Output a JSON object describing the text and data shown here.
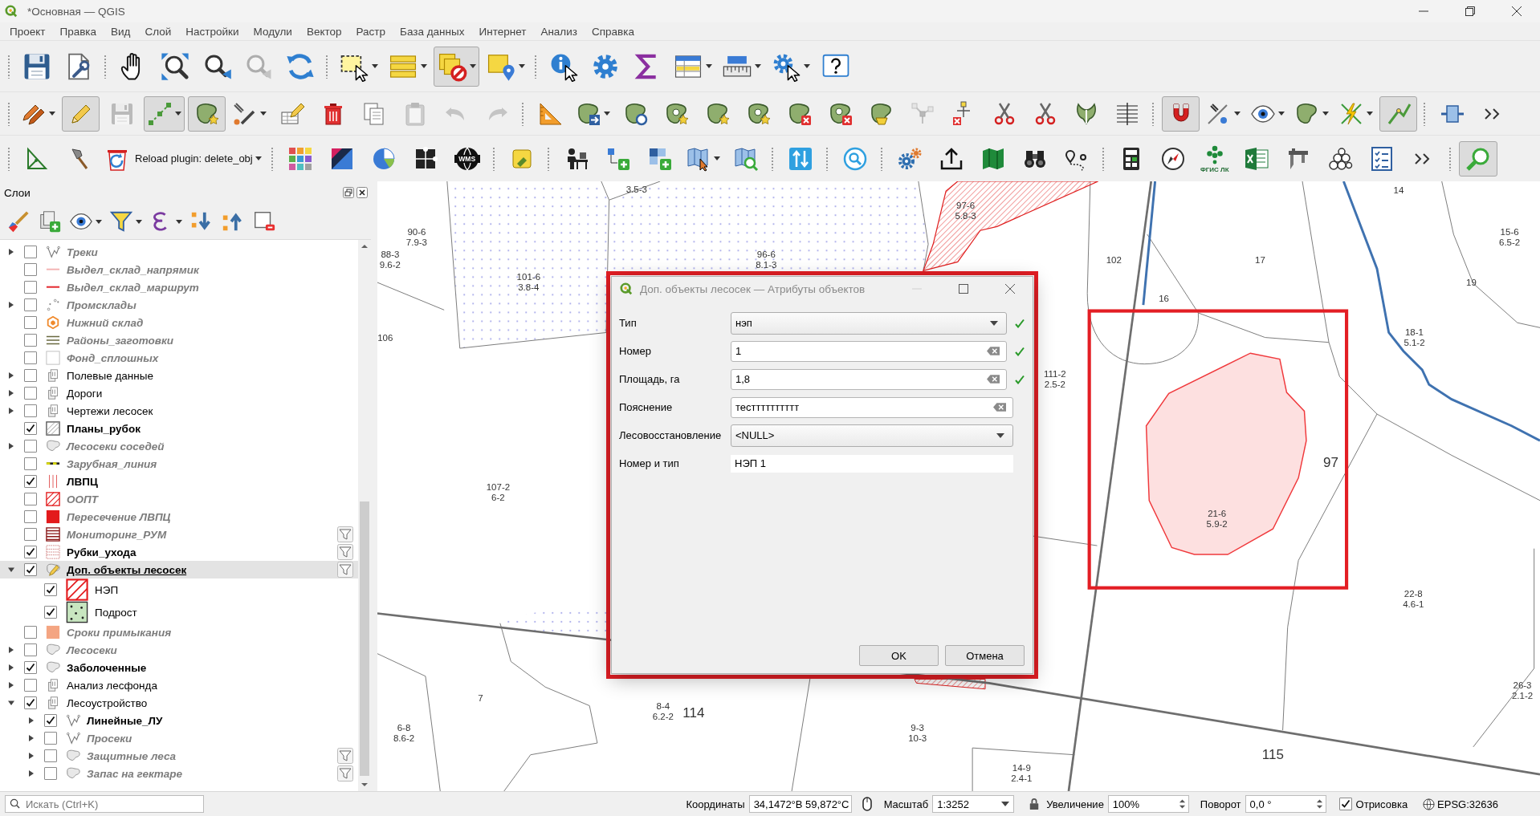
{
  "window": {
    "title": "*Основная — QGIS"
  },
  "menu": [
    "Проект",
    "Правка",
    "Вид",
    "Слой",
    "Настройки",
    "Модули",
    "Вектор",
    "Растр",
    "База данных",
    "Интернет",
    "Анализ",
    "Справка"
  ],
  "toolbars": [
    {
      "buttons": [
        {
          "pressed": false,
          "disabled": false
        },
        {
          "pressed": false,
          "disabled": false
        },
        {
          "pressed": false,
          "disabled": false
        },
        {
          "pressed": false,
          "disabled": false
        },
        {
          "pressed": false,
          "disabled": false
        },
        {
          "pressed": false,
          "disabled": true
        },
        {
          "pressed": false,
          "disabled": false
        },
        {
          "pressed": false,
          "disabled": false
        },
        {
          "pressed": false,
          "disabled": false
        },
        {
          "pressed": true,
          "disabled": false
        },
        {
          "pressed": false,
          "disabled": false
        },
        {
          "pressed": false,
          "disabled": false
        },
        {
          "pressed": false,
          "disabled": false
        },
        {
          "pressed": false,
          "disabled": false
        },
        {
          "pressed": false,
          "disabled": false
        },
        {
          "pressed": false,
          "disabled": false
        },
        {
          "pressed": false,
          "disabled": false
        },
        {
          "pressed": false,
          "disabled": false
        }
      ]
    },
    {
      "buttons": [
        {
          "pressed": false,
          "disabled": false
        },
        {
          "pressed": true,
          "disabled": false
        },
        {
          "pressed": false,
          "disabled": true
        },
        {
          "pressed": true,
          "disabled": false
        },
        {
          "pressed": true,
          "disabled": false
        },
        {
          "pressed": false,
          "disabled": false
        },
        {
          "pressed": false,
          "disabled": false
        },
        {
          "pressed": false,
          "disabled": false
        },
        {
          "pressed": false,
          "disabled": false
        },
        {
          "pressed": false,
          "disabled": true
        },
        {
          "pressed": false,
          "disabled": true
        },
        {
          "pressed": false,
          "disabled": true
        },
        {
          "pressed": false,
          "disabled": false
        },
        {
          "pressed": false,
          "disabled": false
        },
        {
          "pressed": false,
          "disabled": false
        },
        {
          "pressed": false,
          "disabled": false
        },
        {
          "pressed": false,
          "disabled": false
        },
        {
          "pressed": false,
          "disabled": false
        },
        {
          "pressed": false,
          "disabled": false
        },
        {
          "pressed": false,
          "disabled": false
        },
        {
          "pressed": false,
          "disabled": false
        },
        {
          "pressed": false,
          "disabled": true
        },
        {
          "pressed": false,
          "disabled": false
        },
        {
          "pressed": false,
          "disabled": false
        },
        {
          "pressed": false,
          "disabled": false
        },
        {
          "pressed": false,
          "disabled": false
        },
        {
          "pressed": false,
          "disabled": false
        },
        {
          "pressed": true,
          "disabled": false
        },
        {
          "pressed": false,
          "disabled": false
        },
        {
          "pressed": false,
          "disabled": false
        },
        {
          "pressed": false,
          "disabled": false
        },
        {
          "pressed": false,
          "disabled": false
        },
        {
          "pressed": true,
          "disabled": false
        },
        {
          "pressed": false,
          "disabled": false
        },
        {
          "pressed": false,
          "disabled": false
        }
      ]
    },
    {
      "buttons": [
        {
          "pressed": false,
          "disabled": false
        },
        {
          "pressed": false,
          "disabled": false
        },
        {
          "pressed": false,
          "disabled": false,
          "label": "Reload plugin: delete_obj"
        },
        {
          "pressed": false,
          "disabled": false
        },
        {
          "pressed": false,
          "disabled": false
        },
        {
          "pressed": false,
          "disabled": false
        },
        {
          "pressed": false,
          "disabled": false
        },
        {
          "pressed": false,
          "disabled": false,
          "label": "WMS"
        },
        {
          "pressed": false,
          "disabled": false
        },
        {
          "pressed": false,
          "disabled": false
        },
        {
          "pressed": false,
          "disabled": false
        },
        {
          "pressed": false,
          "disabled": false
        },
        {
          "pressed": false,
          "disabled": false
        },
        {
          "pressed": false,
          "disabled": false
        },
        {
          "pressed": false,
          "disabled": false
        },
        {
          "pressed": false,
          "disabled": false
        },
        {
          "pressed": false,
          "disabled": false
        },
        {
          "pressed": false,
          "disabled": false
        },
        {
          "pressed": false,
          "disabled": false
        },
        {
          "pressed": false,
          "disabled": false
        },
        {
          "pressed": false,
          "disabled": false
        },
        {
          "pressed": false,
          "disabled": false
        },
        {
          "pressed": false,
          "disabled": false
        },
        {
          "pressed": false,
          "disabled": false,
          "label": "ФГИС ЛК"
        },
        {
          "pressed": false,
          "disabled": false
        },
        {
          "pressed": false,
          "disabled": false
        },
        {
          "pressed": false,
          "disabled": false
        },
        {
          "pressed": false,
          "disabled": false
        },
        {
          "pressed": false,
          "disabled": false
        },
        {
          "pressed": true,
          "disabled": false
        }
      ]
    }
  ],
  "layers_panel": {
    "title": "Слои",
    "layers": [
      {
        "name": "Треки",
        "kind": "track",
        "legend": false,
        "expandable": true,
        "expanded": false,
        "checked": false,
        "greyed": true,
        "bold": true,
        "selected": false,
        "filtered": false
      },
      {
        "name": "Выдел_склад_напрямик",
        "kind": "line",
        "color": "#f4b4b4",
        "legend": false,
        "expandable": false,
        "expanded": false,
        "checked": false,
        "greyed": true,
        "bold": true,
        "selected": false,
        "filtered": false
      },
      {
        "name": "Выдел_склад_маршрут",
        "kind": "line",
        "color": "#e3262b",
        "legend": false,
        "expandable": false,
        "expanded": false,
        "checked": false,
        "greyed": true,
        "bold": true,
        "selected": false,
        "filtered": false
      },
      {
        "name": "Промсклады",
        "kind": "points",
        "legend": false,
        "expandable": true,
        "expanded": false,
        "checked": false,
        "greyed": true,
        "bold": true,
        "selected": false,
        "filtered": false
      },
      {
        "name": "Нижний склад",
        "kind": "hexagon",
        "legend": false,
        "expandable": false,
        "expanded": false,
        "checked": false,
        "greyed": true,
        "bold": true,
        "selected": false,
        "filtered": false
      },
      {
        "name": "Районы_заготовки",
        "kind": "stripes",
        "legend": false,
        "expandable": false,
        "expanded": false,
        "checked": false,
        "greyed": true,
        "bold": true,
        "selected": false,
        "filtered": false
      },
      {
        "name": "Фонд_сплошных",
        "kind": "blank",
        "legend": false,
        "expandable": false,
        "expanded": false,
        "checked": false,
        "greyed": true,
        "bold": true,
        "selected": false,
        "filtered": false
      },
      {
        "name": "Полевые данные",
        "kind": "group",
        "legend": false,
        "expandable": true,
        "expanded": false,
        "checked": false,
        "greyed": false,
        "bold": false,
        "selected": false,
        "filtered": false
      },
      {
        "name": "Дороги",
        "kind": "group",
        "legend": false,
        "expandable": true,
        "expanded": false,
        "checked": false,
        "greyed": false,
        "bold": false,
        "selected": false,
        "filtered": false
      },
      {
        "name": "Чертежи лесосек",
        "kind": "group",
        "legend": false,
        "expandable": true,
        "expanded": false,
        "checked": false,
        "greyed": false,
        "bold": false,
        "selected": false,
        "filtered": false
      },
      {
        "name": "Планы_рубок",
        "kind": "hatch",
        "legend": false,
        "expandable": false,
        "expanded": false,
        "checked": true,
        "greyed": false,
        "bold": true,
        "selected": false,
        "filtered": false
      },
      {
        "name": "Лесосеки соседей",
        "kind": "blob",
        "legend": false,
        "expandable": true,
        "expanded": false,
        "checked": false,
        "greyed": true,
        "bold": true,
        "selected": false,
        "filtered": false
      },
      {
        "name": "Зарубная_линия",
        "kind": "dashline",
        "legend": false,
        "expandable": false,
        "expanded": false,
        "checked": false,
        "greyed": true,
        "bold": true,
        "selected": false,
        "filtered": false
      },
      {
        "name": "ЛВПЦ",
        "kind": "vlines",
        "legend": false,
        "expandable": false,
        "expanded": false,
        "checked": true,
        "greyed": false,
        "bold": true,
        "selected": false,
        "filtered": false
      },
      {
        "name": "ООПТ",
        "kind": "diagonal",
        "legend": false,
        "expandable": false,
        "expanded": false,
        "checked": false,
        "greyed": true,
        "bold": true,
        "selected": false,
        "filtered": false
      },
      {
        "name": "Пересечение ЛВПЦ",
        "kind": "fill",
        "color": "#e31a1c",
        "legend": false,
        "expandable": false,
        "expanded": false,
        "checked": false,
        "greyed": true,
        "bold": true,
        "selected": false,
        "filtered": false
      },
      {
        "name": "Мониторинг_РУМ",
        "kind": "bars",
        "legend": false,
        "expandable": false,
        "expanded": false,
        "checked": false,
        "greyed": true,
        "bold": true,
        "selected": false,
        "filtered": true
      },
      {
        "name": "Рубки_ухода",
        "kind": "grid",
        "legend": false,
        "expandable": false,
        "expanded": false,
        "checked": true,
        "greyed": false,
        "bold": true,
        "selected": false,
        "filtered": true
      },
      {
        "name": "Доп. объекты лесосек",
        "kind": "edit",
        "legend": false,
        "expandable": true,
        "expanded": true,
        "checked": true,
        "greyed": false,
        "bold": true,
        "selected": true,
        "filtered": true,
        "children": [
          {
            "name": "НЭП",
            "kind": "diagonal",
            "legend": true,
            "expandable": false,
            "expanded": false,
            "checked": true,
            "greyed": false,
            "bold": false,
            "selected": false,
            "filtered": false
          },
          {
            "name": "Подрост",
            "kind": "dots",
            "legend": true,
            "expandable": false,
            "expanded": false,
            "checked": true,
            "greyed": false,
            "bold": false,
            "selected": false,
            "filtered": false
          }
        ]
      },
      {
        "name": "Сроки примыкания",
        "kind": "fill",
        "color": "#f4a582",
        "legend": false,
        "expandable": false,
        "expanded": false,
        "checked": false,
        "greyed": true,
        "bold": true,
        "selected": false,
        "filtered": false
      },
      {
        "name": "Лесосеки",
        "kind": "blob",
        "legend": false,
        "expandable": true,
        "expanded": false,
        "checked": false,
        "greyed": true,
        "bold": true,
        "selected": false,
        "filtered": false
      },
      {
        "name": "Заболоченные",
        "kind": "blob",
        "legend": false,
        "expandable": true,
        "expanded": false,
        "checked": true,
        "greyed": false,
        "bold": true,
        "selected": false,
        "filtered": false
      },
      {
        "name": "Анализ лесфонда",
        "kind": "group",
        "legend": false,
        "expandable": true,
        "expanded": false,
        "checked": false,
        "greyed": false,
        "bold": false,
        "selected": false,
        "filtered": false
      },
      {
        "name": "Лесоустройство",
        "kind": "group",
        "legend": false,
        "expandable": true,
        "expanded": true,
        "checked": true,
        "greyed": false,
        "bold": false,
        "selected": false,
        "filtered": false,
        "children": [
          {
            "name": "Линейные_ЛУ",
            "kind": "track",
            "legend": false,
            "expandable": true,
            "expanded": false,
            "checked": true,
            "greyed": false,
            "bold": true,
            "selected": false,
            "filtered": false
          },
          {
            "name": "Просеки",
            "kind": "track",
            "legend": false,
            "expandable": true,
            "expanded": false,
            "checked": false,
            "greyed": true,
            "bold": true,
            "selected": false,
            "filtered": false
          },
          {
            "name": "Защитные леса",
            "kind": "blob",
            "legend": false,
            "expandable": true,
            "expanded": false,
            "checked": false,
            "greyed": true,
            "bold": true,
            "selected": false,
            "filtered": true
          },
          {
            "name": "Запас на гектаре",
            "kind": "blob",
            "legend": false,
            "expandable": true,
            "expanded": false,
            "checked": false,
            "greyed": true,
            "bold": true,
            "selected": false,
            "filtered": true
          }
        ]
      }
    ]
  },
  "map": {
    "labels": [
      {
        "lines": [
          "3.5-3"
        ],
        "kind": "parcel"
      },
      {
        "lines": [
          "14"
        ],
        "kind": "parcel"
      },
      {
        "lines": [
          "97-6",
          "5.8-3"
        ],
        "kind": "parcel"
      },
      {
        "lines": [
          "90-6",
          "7.9-3"
        ],
        "kind": "parcel"
      },
      {
        "lines": [
          "15-6",
          "6.5-2"
        ],
        "kind": "parcel"
      },
      {
        "lines": [
          "88-3",
          "9.6-2"
        ],
        "kind": "parcel"
      },
      {
        "lines": [
          "96-6",
          "8.1-3"
        ],
        "kind": "parcel"
      },
      {
        "lines": [
          "102"
        ],
        "kind": "parcel"
      },
      {
        "lines": [
          "17"
        ],
        "kind": "parcel"
      },
      {
        "lines": [
          "101-6",
          "3.8-4"
        ],
        "kind": "parcel"
      },
      {
        "lines": [
          "19"
        ],
        "kind": "parcel"
      },
      {
        "lines": [
          "16"
        ],
        "kind": "parcel"
      },
      {
        "lines": [
          "106"
        ],
        "kind": "parcel"
      },
      {
        "lines": [
          "18-1",
          "5.1-2"
        ],
        "kind": "parcel"
      },
      {
        "lines": [
          "111-2",
          "2.5-2"
        ],
        "kind": "parcel"
      },
      {
        "lines": [
          "97"
        ],
        "kind": "block"
      },
      {
        "lines": [
          "107-2",
          "6-2"
        ],
        "kind": "parcel"
      },
      {
        "lines": [
          "21-6",
          "5.9-2"
        ],
        "kind": "parcel"
      },
      {
        "lines": [
          "22-8",
          "4.6-1"
        ],
        "kind": "parcel"
      },
      {
        "lines": [
          "7"
        ],
        "kind": "parcel"
      },
      {
        "lines": [
          "26-3",
          "2.1-2"
        ],
        "kind": "parcel"
      },
      {
        "lines": [
          "8-4",
          "6.2-2"
        ],
        "kind": "parcel"
      },
      {
        "lines": [
          "114"
        ],
        "kind": "block"
      },
      {
        "lines": [
          "6-8",
          "8.6-2"
        ],
        "kind": "parcel"
      },
      {
        "lines": [
          "9-3",
          "10-3"
        ],
        "kind": "parcel"
      },
      {
        "lines": [
          "115"
        ],
        "kind": "block"
      },
      {
        "lines": [
          "14-9",
          "2.4-1"
        ],
        "kind": "parcel"
      }
    ]
  },
  "dialog": {
    "title": "Доп. объекты лесосек — Атрибуты объектов",
    "fields": [
      {
        "label": "Тип",
        "kind": "dropdown",
        "value": "нэп",
        "valid": true
      },
      {
        "label": "Номер",
        "kind": "text",
        "value": "1",
        "valid": true
      },
      {
        "label": "Площадь, га",
        "kind": "text",
        "value": "1,8",
        "valid": true
      },
      {
        "label": "Пояснение",
        "kind": "text",
        "value": "тестттттттттт",
        "valid": false
      },
      {
        "label": "Лесовосстановление",
        "kind": "dropdown",
        "value": "<NULL>",
        "valid": false
      },
      {
        "label": "Номер и тип",
        "kind": "readonly",
        "value": "НЭП 1",
        "valid": false
      }
    ],
    "buttons": [
      "OK",
      "Отмена"
    ]
  },
  "status_bar": {
    "search": {
      "placeholder": "Искать (Ctrl+K)"
    },
    "coordinate_label": "Координаты",
    "coordinate": "34,1472°В 59,872°С",
    "scale_label": "Масштаб",
    "scale": "1:3252",
    "magnifier_label": "Увеличение",
    "magnifier": "100%",
    "rotation_label": "Поворот",
    "rotation": "0,0 °",
    "render": {
      "label": "Отрисовка",
      "checked": true
    },
    "crs": "EPSG:32636"
  }
}
